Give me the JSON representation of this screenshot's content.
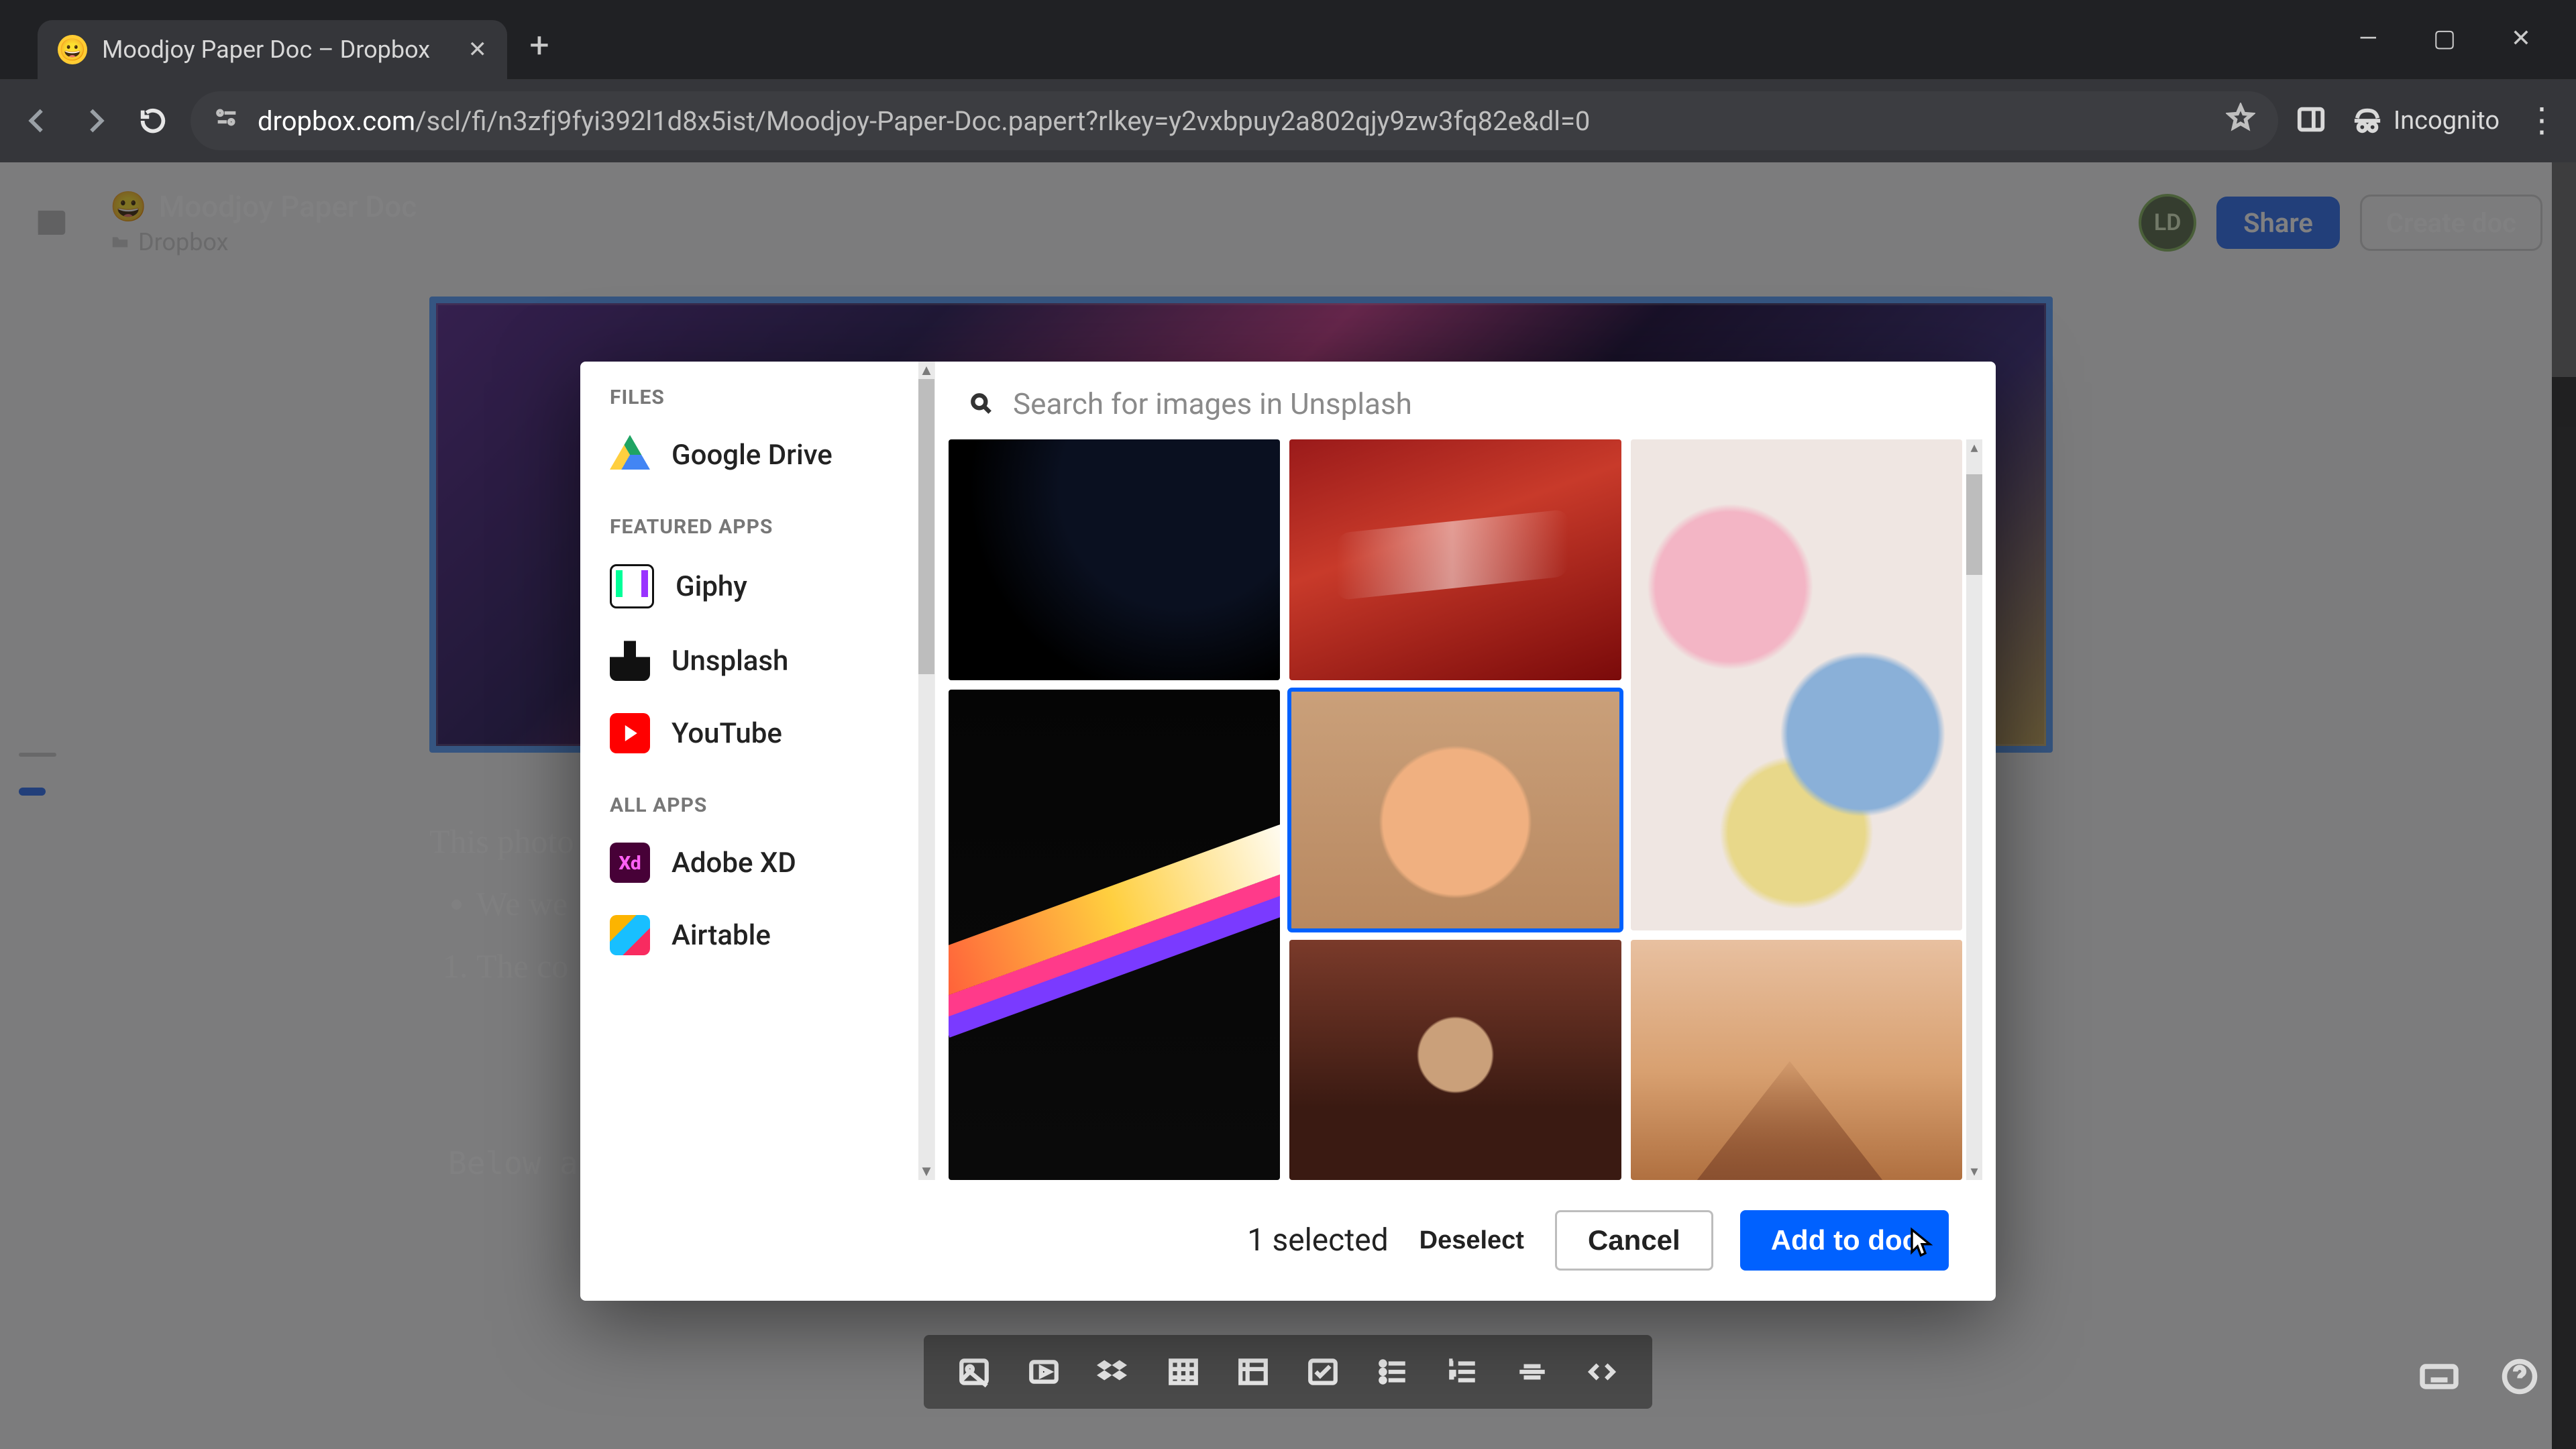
{
  "browser": {
    "tab_title": "Moodjoy Paper Doc – Dropbox",
    "url_host": "dropbox.com",
    "url_path": "/scl/fi/n3zfj9fyi392l1d8x5ist/Moodjoy-Paper-Doc.papert?rlkey=y2vxbpuy2a802qjy9zw3fq82e&dl=0",
    "incognito_label": "Incognito"
  },
  "header": {
    "doc_emoji": "😀",
    "doc_title": "Moodjoy Paper Doc",
    "breadcrumb": "Dropbox",
    "avatar_initials": "LD",
    "share_label": "Share",
    "create_label": "Create doc"
  },
  "doc": {
    "caption_line": "This photo",
    "bullet_line": "We we",
    "number_line": "The co",
    "code_caption": "Below a"
  },
  "modal": {
    "section_files": "FILES",
    "section_featured": "FEATURED APPS",
    "section_all": "ALL APPS",
    "apps": {
      "gdrive": "Google Drive",
      "giphy": "Giphy",
      "unsplash": "Unsplash",
      "youtube": "YouTube",
      "adobexd": "Adobe XD",
      "airtable": "Airtable"
    },
    "search_placeholder": "Search for images in Unsplash",
    "selected_count_label": "1 selected",
    "deselect_label": "Deselect",
    "cancel_label": "Cancel",
    "add_label": "Add to doc"
  }
}
